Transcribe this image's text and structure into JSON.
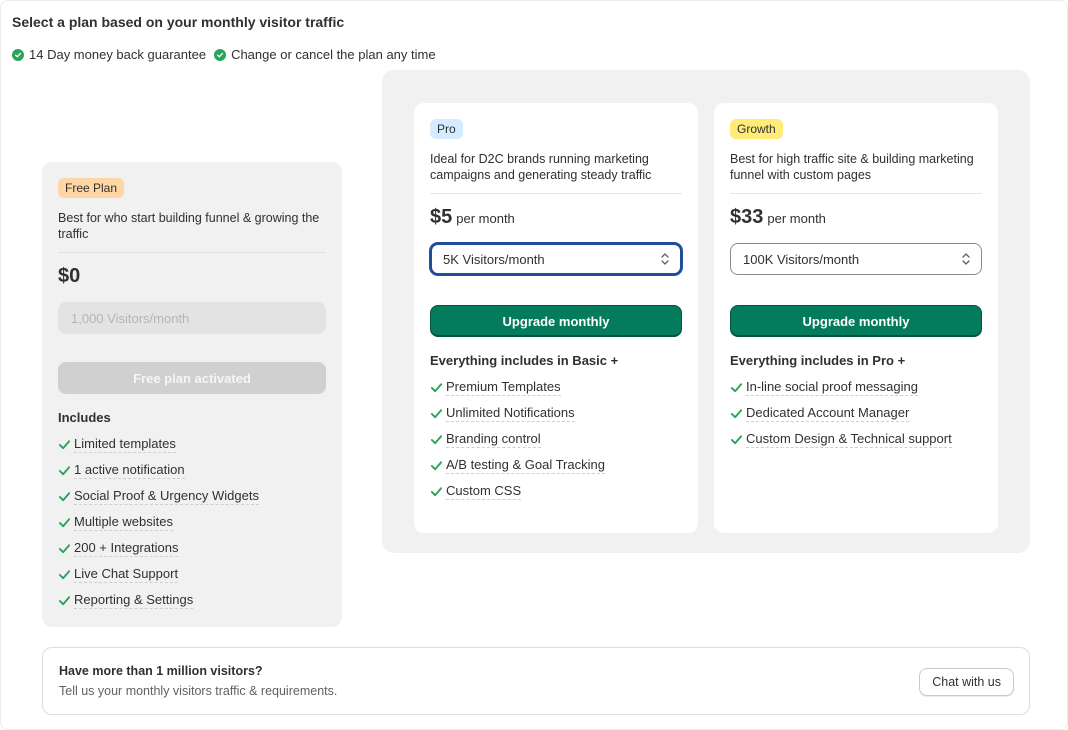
{
  "heading": "Select a plan based on your monthly visitor traffic",
  "guarantees": [
    "14 Day money back guarantee",
    "Change or cancel the plan any time"
  ],
  "colors": {
    "accent_green": "#047b5d",
    "check_green": "#29a45a",
    "focus_blue": "#1f4f9a"
  },
  "plans": {
    "free": {
      "badge": "Free Plan",
      "description": "Best for who start building funnel & growing the traffic",
      "price": "$0",
      "visitors_placeholder": "1,000 Visitors/month",
      "button": "Free plan activated",
      "includes_title": "Includes",
      "features": [
        "Limited templates",
        "1 active notification",
        "Social Proof & Urgency Widgets",
        "Multiple websites",
        "200 + Integrations",
        "Live Chat Support",
        "Reporting & Settings"
      ]
    },
    "pro": {
      "badge": "Pro",
      "description": "Ideal for D2C brands running marketing campaigns and generating steady traffic",
      "price": "$5",
      "period": "per month",
      "visitors_selected": "5K Visitors/month",
      "button": "Upgrade monthly",
      "includes_title": "Everything includes in Basic +",
      "features": [
        "Premium Templates",
        "Unlimited Notifications",
        "Branding control",
        "A/B testing & Goal Tracking",
        "Custom CSS"
      ]
    },
    "growth": {
      "badge": "Growth",
      "description": "Best for high traffic site & building marketing funnel with custom pages",
      "price": "$33",
      "period": "per month",
      "visitors_selected": "100K Visitors/month",
      "button": "Upgrade monthly",
      "includes_title": "Everything includes in Pro +",
      "features": [
        "In-line social proof messaging",
        "Dedicated Account Manager",
        "Custom Design & Technical support"
      ]
    }
  },
  "enterprise": {
    "title": "Have more than 1 million visitors?",
    "subtitle": "Tell us your monthly visitors traffic & requirements.",
    "button": "Chat with us"
  }
}
